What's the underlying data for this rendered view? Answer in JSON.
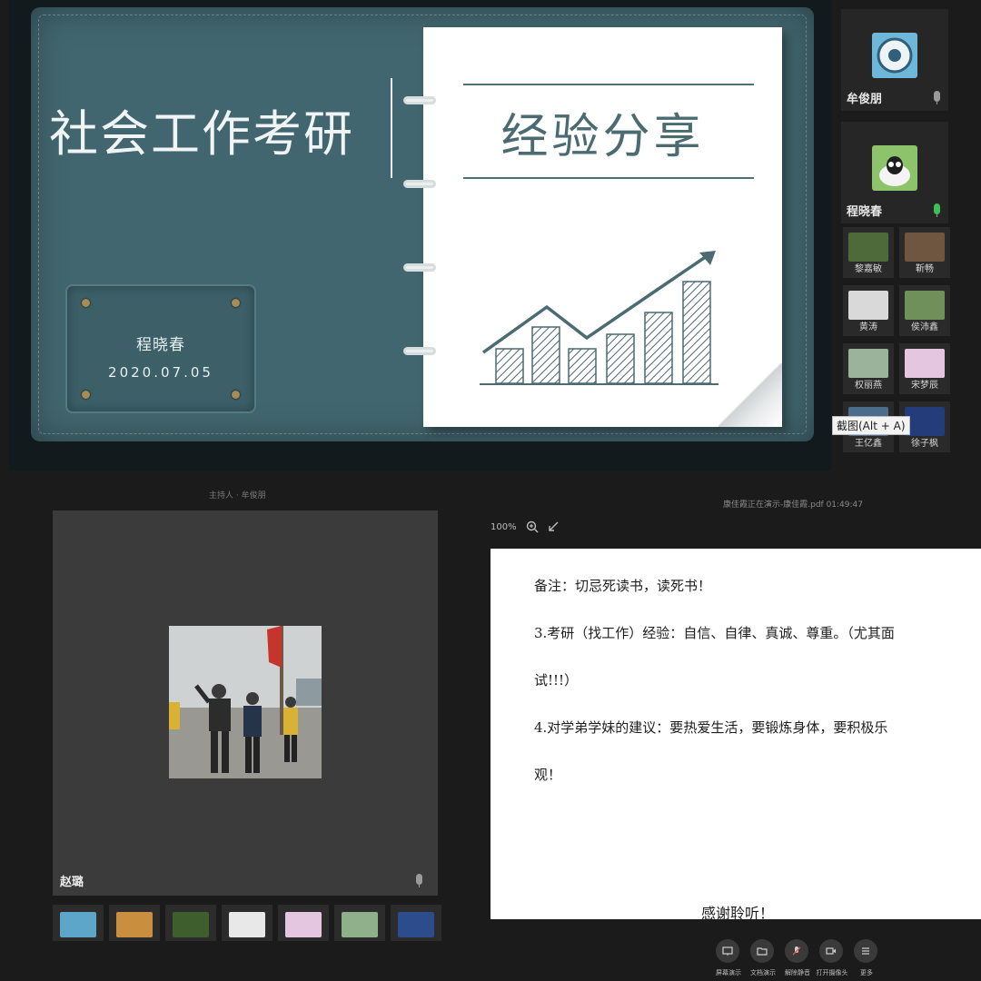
{
  "slide": {
    "title": "社会工作考研",
    "paper_title": "经验分享",
    "presenter": "程晓春",
    "date": "2020.07.05"
  },
  "participants": {
    "main": [
      {
        "name": "牟俊朋",
        "icon": "avatar-gear",
        "mic": "muted"
      },
      {
        "name": "程晓春",
        "icon": "avatar-sheep",
        "mic": "active"
      }
    ],
    "small": [
      {
        "name": "黎嘉敏",
        "color": "#4f6a3a"
      },
      {
        "name": "靳畅",
        "color": "#6e5640"
      },
      {
        "name": "黄涛",
        "color": "#d9d9d9"
      },
      {
        "name": "侯沛鑫",
        "color": "#6f8f5b"
      },
      {
        "name": "权丽燕",
        "color": "#9ab39a"
      },
      {
        "name": "宋梦辰",
        "color": "#e4c6e0"
      },
      {
        "name": "王亿鑫",
        "color": "#4c6c8c"
      },
      {
        "name": "徐子枫",
        "color": "#243c7a"
      }
    ],
    "tooltip": "截图(Alt + A)"
  },
  "video": {
    "host_label": "主持人 · 牟俊朋",
    "name": "赵璐"
  },
  "thumbs": [
    "#5ea6c9",
    "#c98f3f",
    "#3f5e2e",
    "#e8e8e8",
    "#e4c6e0",
    "#8fb08a",
    "#2d4c8c"
  ],
  "document": {
    "status": "康佳霞正在演示-康佳霞.pdf 01:49:47",
    "zoom": "100%",
    "lines": [
      "备注：切忌死读书，读死书！",
      "3.考研（找工作）经验：自信、自律、真诚、尊重。（尤其面",
      "试!!!）",
      "4.对学弟学妹的建议：要热爱生活，要锻炼身体，要积极乐",
      "观！"
    ],
    "thanks": "感谢聆听！"
  },
  "toolbar": [
    {
      "label": "屏幕演示",
      "icon": "screen-share-icon"
    },
    {
      "label": "文档演示",
      "icon": "folder-icon"
    },
    {
      "label": "解除静音",
      "icon": "microphone-icon"
    },
    {
      "label": "打开摄像头",
      "icon": "camera-icon"
    },
    {
      "label": "更多",
      "icon": "more-icon"
    }
  ],
  "colors": {
    "slide_bg": "#42666f",
    "chart_stroke": "#4b6b72",
    "app_bg": "#1b1b1c"
  }
}
